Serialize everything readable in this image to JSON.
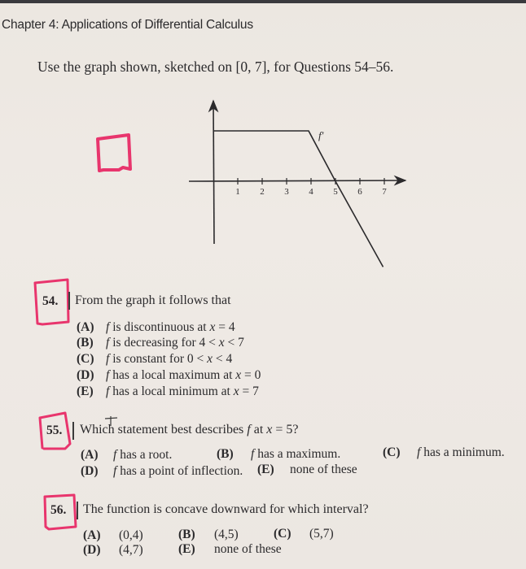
{
  "header": {
    "chapter_title": "Chapter 4: Applications of Differential Calculus",
    "intro": "Use the graph shown, sketched on [0, 7], for Questions 54–56."
  },
  "chart_data": {
    "type": "line",
    "title": "",
    "curve_label": "f'",
    "xlabel": "",
    "ylabel": "",
    "x_ticks": [
      "1",
      "2",
      "3",
      "4",
      "5",
      "6",
      "7"
    ],
    "xlim": [
      0,
      7
    ],
    "series": [
      {
        "name": "f'",
        "x": [
          0,
          3.9,
          5,
          6.95
        ],
        "y": [
          2,
          2,
          0,
          -3.4
        ]
      }
    ],
    "grid": false,
    "legend": "none"
  },
  "annotations": {
    "ink_color": "#e8356d",
    "empty_box": "hand-drawn box"
  },
  "questions": [
    {
      "number": "54.",
      "prompt": "From the graph it follows that",
      "options": [
        {
          "letter": "(A)",
          "text_f": "f",
          "text": " is discontinuous at ",
          "text_var": "x",
          "text_tail": " = 4"
        },
        {
          "letter": "(B)",
          "text_f": "f",
          "text": " is decreasing for 4 < ",
          "text_var": "x",
          "text_tail": " < 7"
        },
        {
          "letter": "(C)",
          "text_f": "f",
          "text": " is constant for 0 < ",
          "text_var": "x",
          "text_tail": " < 4"
        },
        {
          "letter": "(D)",
          "text_f": "f",
          "text": " has a local maximum at ",
          "text_var": "x",
          "text_tail": " = 0"
        },
        {
          "letter": "(E)",
          "text_f": "f",
          "text": " has a local minimum at ",
          "text_var": "x",
          "text_tail": " = 7"
        }
      ]
    },
    {
      "number": "55.",
      "prompt_pre": "Which statement best describes ",
      "prompt_f": "f",
      "prompt_mid": " at ",
      "prompt_var": "x",
      "prompt_tail": " = 5?",
      "options": [
        {
          "letter": "(A)",
          "text_f": "f",
          "text": " has a root."
        },
        {
          "letter": "(B)",
          "text_f": "f",
          "text": " has a maximum."
        },
        {
          "letter": "(C)",
          "text_f": "f",
          "text": " has a minimum."
        },
        {
          "letter": "(D)",
          "text_f": "f",
          "text": " has a point of inflection."
        },
        {
          "letter": "(E)",
          "text_f": "",
          "text": "none of these"
        }
      ]
    },
    {
      "number": "56.",
      "prompt": "The function is concave downward for which interval?",
      "options": [
        {
          "letter": "(A)",
          "text": "(0,4)"
        },
        {
          "letter": "(B)",
          "text": "(4,5)"
        },
        {
          "letter": "(C)",
          "text": "(5,7)"
        },
        {
          "letter": "(D)",
          "text": "(4,7)"
        },
        {
          "letter": "(E)",
          "text": "none of these"
        }
      ]
    }
  ]
}
